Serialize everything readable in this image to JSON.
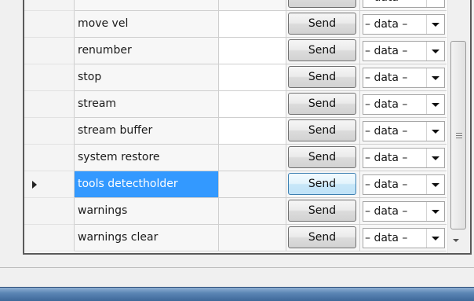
{
  "grid": {
    "rows": [
      {
        "name": "",
        "send_label": "Send",
        "combo_value": "– data –",
        "selected": false,
        "blank": true
      },
      {
        "name": "move vel",
        "send_label": "Send",
        "combo_value": "– data –",
        "selected": false,
        "blank": false
      },
      {
        "name": "renumber",
        "send_label": "Send",
        "combo_value": "– data –",
        "selected": false,
        "blank": false
      },
      {
        "name": "stop",
        "send_label": "Send",
        "combo_value": "– data –",
        "selected": false,
        "blank": false
      },
      {
        "name": "stream",
        "send_label": "Send",
        "combo_value": "– data –",
        "selected": false,
        "blank": false
      },
      {
        "name": "stream buffer",
        "send_label": "Send",
        "combo_value": "– data –",
        "selected": false,
        "blank": false
      },
      {
        "name": "system restore",
        "send_label": "Send",
        "combo_value": "– data –",
        "selected": false,
        "blank": true
      },
      {
        "name": "tools detectholder",
        "send_label": "Send",
        "combo_value": "– data –",
        "selected": true,
        "blank": true
      },
      {
        "name": "warnings",
        "send_label": "Send",
        "combo_value": "– data –",
        "selected": false,
        "blank": true
      },
      {
        "name": "warnings clear",
        "send_label": "Send",
        "combo_value": "– data –",
        "selected": false,
        "blank": true
      }
    ]
  },
  "icons": {
    "row_indicator": "current-row-arrow-icon",
    "combo_toggle": "dropdown-arrow-icon",
    "scroll_grip": "grip-icon",
    "scroll_down": "scroll-down-arrow-icon"
  },
  "colors": {
    "selection": "#3399ff",
    "selection_text": "#ffffff",
    "grid_border": "#5a5a5a",
    "taskbar": "#5c86b5"
  }
}
